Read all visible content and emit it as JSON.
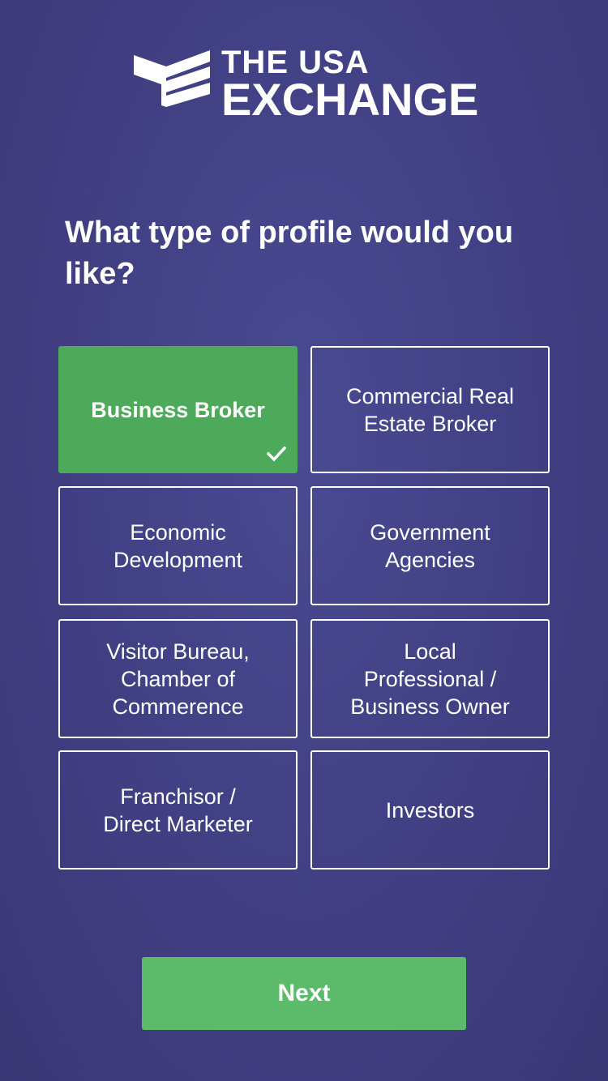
{
  "brand": {
    "line1": "THE USA",
    "line2": "EXCHANGE",
    "icon": "flag-logo-icon"
  },
  "question": "What type of profile would you like?",
  "options": [
    {
      "label": "Business Broker",
      "selected": true
    },
    {
      "label": "Commercial Real\nEstate Broker",
      "selected": false
    },
    {
      "label": "Economic\nDevelopment",
      "selected": false
    },
    {
      "label": "Government\nAgencies",
      "selected": false
    },
    {
      "label": "Visitor Bureau,\nChamber of\nCommerence",
      "selected": false
    },
    {
      "label": "Local\nProfessional /\nBusiness Owner",
      "selected": false
    },
    {
      "label": "Franchisor /\nDirect Marketer",
      "selected": false
    },
    {
      "label": "Investors",
      "selected": false
    }
  ],
  "selected_check_icon": "checkmark-icon",
  "next_label": "Next",
  "colors": {
    "background": "#413f82",
    "selected": "#4caa5a",
    "button": "#5cba6b",
    "text": "#ffffff"
  }
}
